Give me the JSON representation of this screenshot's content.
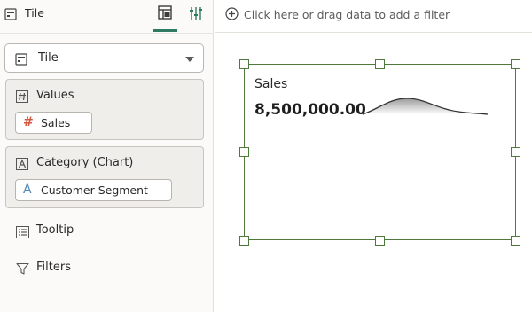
{
  "panel": {
    "title": "Tile",
    "visualization_type": "Tile",
    "values_zone": {
      "title": "Values",
      "item": "Sales"
    },
    "category_zone": {
      "title": "Category (Chart)",
      "item": "Customer Segment"
    },
    "tooltip_label": "Tooltip",
    "filters_label": "Filters"
  },
  "filter_bar": {
    "hint": "Click here or drag data to add a filter"
  },
  "tile": {
    "measure_name": "Sales",
    "measure_value": "8,500,000.00"
  },
  "colors": {
    "accent": "#2e7a62",
    "selection_border": "#4d7a3c",
    "measure_icon": "#d6553e",
    "attribute_icon": "#4b86b6"
  },
  "icons": {
    "panel_title": "tile-icon",
    "layout_tab": "layout-panel-icon",
    "properties_tab": "sliders-icon",
    "values_zone": "hash-box-icon",
    "category_zone": "letter-a-box-icon",
    "tooltip": "list-icon",
    "filters": "funnel-icon",
    "filter_add": "plus-circle-icon"
  }
}
